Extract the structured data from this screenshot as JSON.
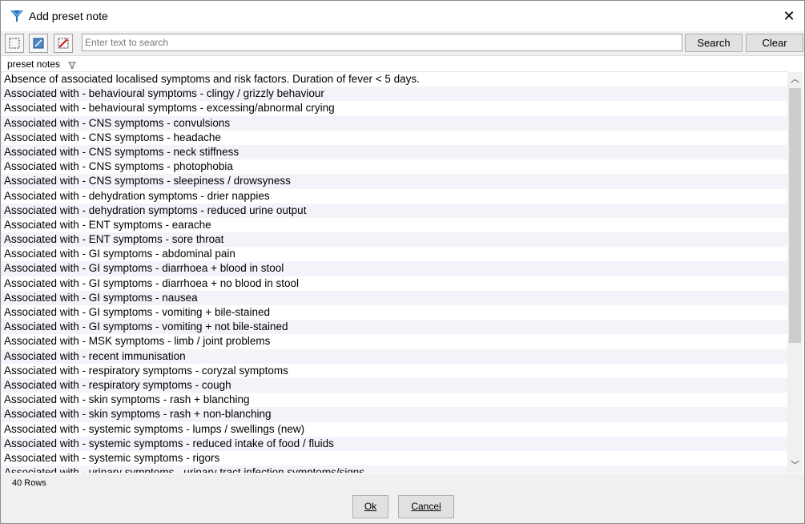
{
  "window": {
    "title": "Add preset note",
    "close_label": "✕"
  },
  "toolbar": {
    "select_all_icon": "select-all-icon",
    "select_mark_icon": "select-marked-icon",
    "deselect_icon": "deselect-icon",
    "search_placeholder": "Enter text to search",
    "search_value": "",
    "search_label": "Search",
    "clear_label": "Clear"
  },
  "grid": {
    "column_header": "preset notes",
    "rows": [
      "Absence of associated localised symptoms and risk factors. Duration of fever < 5 days.",
      "Associated with - behavioural symptoms - clingy / grizzly behaviour",
      "Associated with - behavioural symptoms - excessing/abnormal crying",
      "Associated with - CNS symptoms - convulsions",
      "Associated with - CNS symptoms - headache",
      "Associated with - CNS symptoms - neck stiffness",
      "Associated with - CNS symptoms - photophobia",
      "Associated with - CNS symptoms - sleepiness / drowsyness",
      "Associated with - dehydration symptoms - drier nappies",
      "Associated with - dehydration symptoms - reduced urine output",
      "Associated with - ENT symptoms - earache",
      "Associated with - ENT symptoms - sore throat",
      "Associated with - GI symptoms - abdominal pain",
      "Associated with - GI symptoms - diarrhoea + blood in stool",
      "Associated with - GI symptoms - diarrhoea + no blood in stool",
      "Associated with - GI symptoms - nausea",
      "Associated with - GI symptoms - vomiting + bile-stained",
      "Associated with - GI symptoms - vomiting + not bile-stained",
      "Associated with - MSK symptoms - limb / joint problems",
      "Associated with - recent immunisation",
      "Associated with - respiratory symptoms - coryzal symptoms",
      "Associated with - respiratory symptoms - cough",
      "Associated with - skin symptoms - rash + blanching",
      "Associated with - skin symptoms - rash + non-blanching",
      "Associated with - systemic symptoms - lumps / swellings (new)",
      "Associated with - systemic symptoms - reduced intake of food / fluids",
      "Associated with - systemic symptoms - rigors",
      "Associated with - urinary symptoms - urinary tract infection symptoms/signs"
    ]
  },
  "status": {
    "row_count": "40 Rows"
  },
  "footer": {
    "ok_label": "Ok",
    "cancel_label": "Cancel"
  }
}
